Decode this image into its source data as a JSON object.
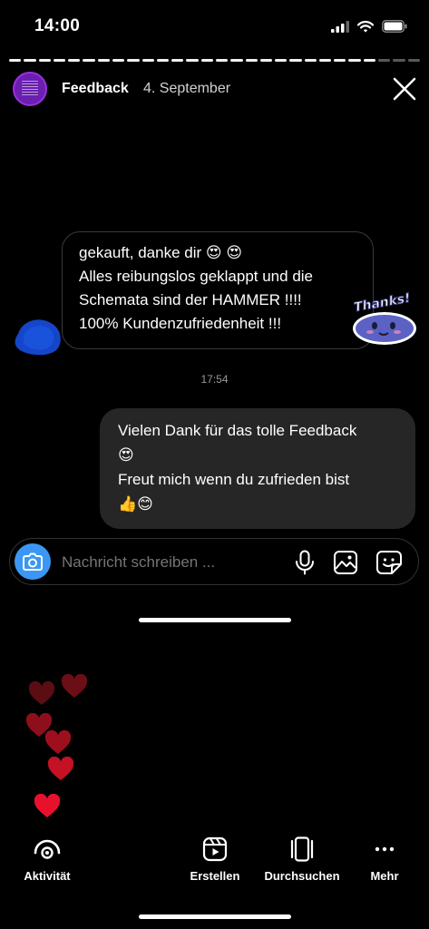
{
  "status_bar": {
    "time": "14:00"
  },
  "story": {
    "title": "Feedback",
    "date": "4. September",
    "segments_total": 28,
    "segments_viewed": 25
  },
  "messages": {
    "received": {
      "lines": [
        "gekauft, danke dir 😍 😍",
        "Alles reibungslos geklappt und die",
        "Schemata sind der HAMMER !!!!",
        "100% Kundenzufriedenheit !!!"
      ],
      "sticker_text": "Thanks!"
    },
    "timestamp": "17:54",
    "sent": {
      "lines": [
        "Vielen Dank für das tolle Feedback",
        "😍",
        "Freut mich wenn du zufrieden bist",
        "👍😊"
      ]
    }
  },
  "composer": {
    "placeholder": "Nachricht schreiben ..."
  },
  "bottom_nav": {
    "activity": "Aktivität",
    "create": "Erstellen",
    "browse": "Durchsuchen",
    "more": "Mehr"
  },
  "colors": {
    "camera_button": "#3b97f3",
    "avatar": "#6a1fb0",
    "sent_bubble": "#262626",
    "heart_bright": "#e8112d",
    "heart_dark": "#5a0d12"
  }
}
